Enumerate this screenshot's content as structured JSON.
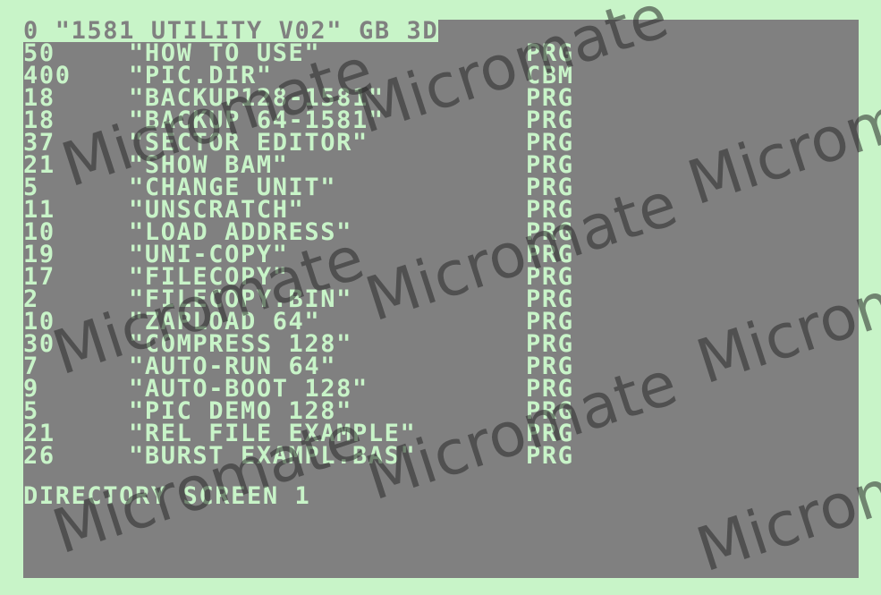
{
  "colors": {
    "border": "#c8f4c8",
    "screen_background": "#808080",
    "text": "#c8f4c8"
  },
  "header": "0 \"1581 UTILITY V02\" GB 3D",
  "entries": [
    {
      "blocks": "50",
      "name": "\"HOW TO USE\"",
      "type": "PRG"
    },
    {
      "blocks": "400",
      "name": "\"PIC.DIR\"",
      "type": "CBM"
    },
    {
      "blocks": "18",
      "name": "\"BACKUP128-1581\"",
      "type": "PRG"
    },
    {
      "blocks": "18",
      "name": "\"BACKUP 64-1581\"",
      "type": "PRG"
    },
    {
      "blocks": "37",
      "name": "\"SECTOR EDITOR\"",
      "type": "PRG"
    },
    {
      "blocks": "21",
      "name": "\"SHOW BAM\"",
      "type": "PRG"
    },
    {
      "blocks": "5",
      "name": "\"CHANGE UNIT\"",
      "type": "PRG"
    },
    {
      "blocks": "11",
      "name": "\"UNSCRATCH\"",
      "type": "PRG"
    },
    {
      "blocks": "10",
      "name": "\"LOAD ADDRESS\"",
      "type": "PRG"
    },
    {
      "blocks": "19",
      "name": "\"UNI-COPY\"",
      "type": "PRG"
    },
    {
      "blocks": "17",
      "name": "\"FILECOPY\"",
      "type": "PRG"
    },
    {
      "blocks": "2",
      "name": "\"FILECOPY.BIN\"",
      "type": "PRG"
    },
    {
      "blocks": "10",
      "name": "\"ZAPLOAD 64\"",
      "type": "PRG"
    },
    {
      "blocks": "30",
      "name": "\"COMPRESS 128\"",
      "type": "PRG"
    },
    {
      "blocks": "7",
      "name": "\"AUTO-RUN 64\"",
      "type": "PRG"
    },
    {
      "blocks": "9",
      "name": "\"AUTO-BOOT 128\"",
      "type": "PRG"
    },
    {
      "blocks": "5",
      "name": "\"PIC DEMO 128\"",
      "type": "PRG"
    },
    {
      "blocks": "21",
      "name": "\"REL FILE EXAMPLE\"",
      "type": "PRG"
    },
    {
      "blocks": "26",
      "name": "\"BURST EXAMPL.BAS\"",
      "type": "PRG"
    }
  ],
  "footer": "DIRECTORY SCREEN 1",
  "watermark": "Micromate"
}
